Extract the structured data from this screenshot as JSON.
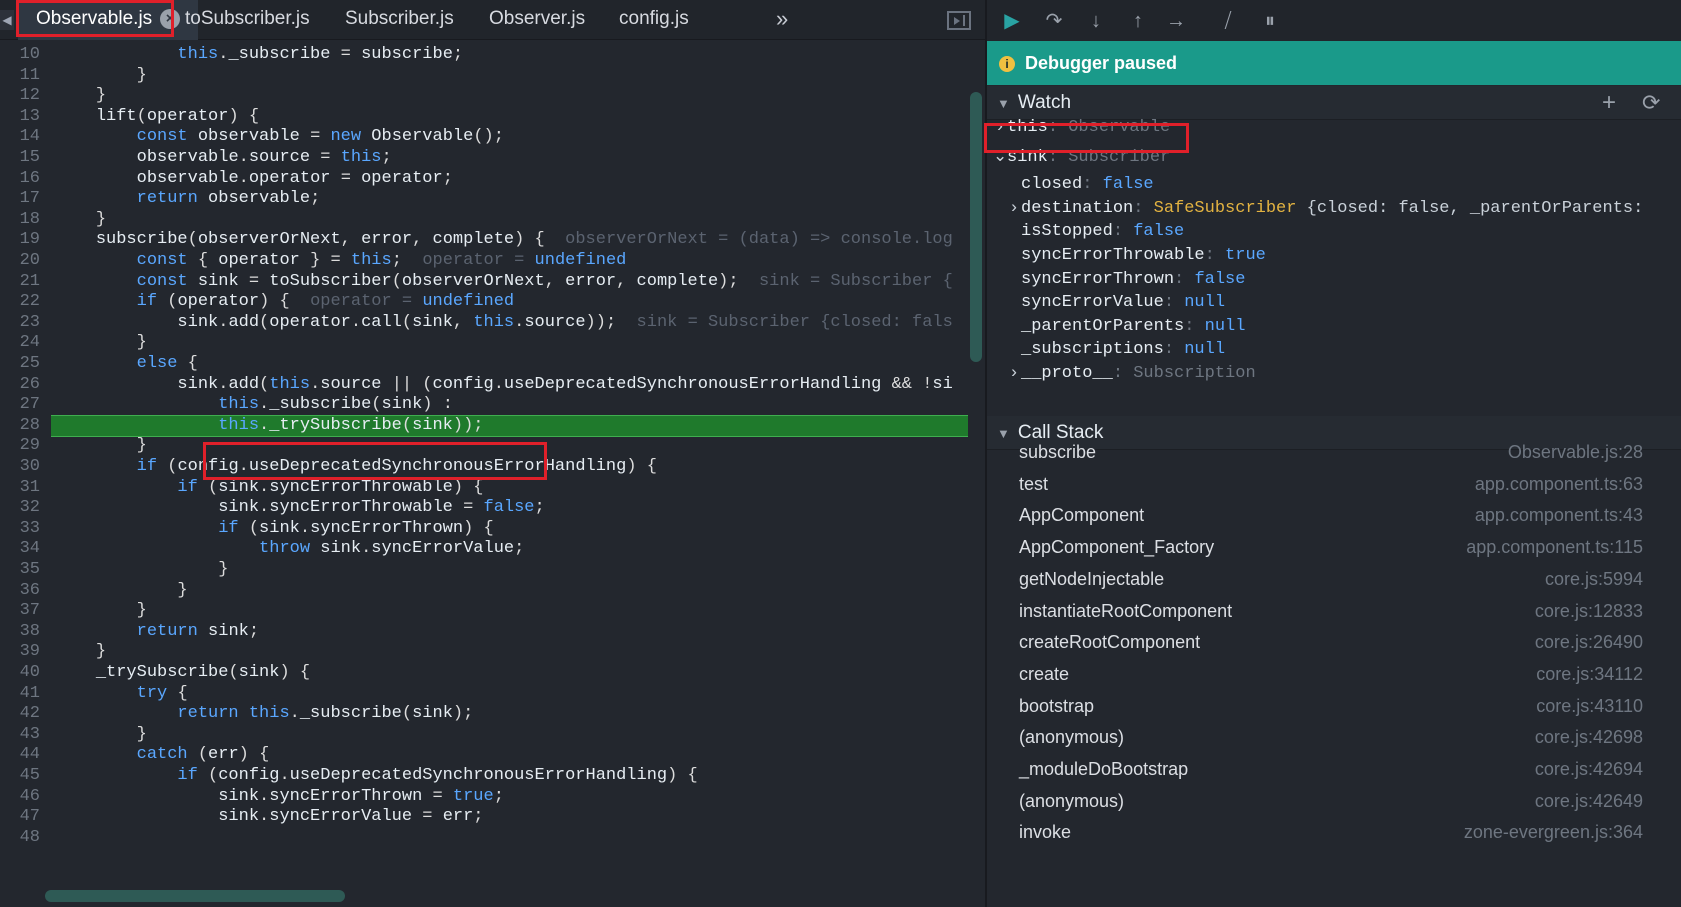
{
  "tabs": {
    "items": [
      {
        "label": "Observable.js",
        "active": true
      },
      {
        "label": "toSubscriber.js"
      },
      {
        "label": "Subscriber.js"
      },
      {
        "label": "Observer.js"
      },
      {
        "label": "config.js"
      }
    ],
    "more": "»",
    "close": "×"
  },
  "editor": {
    "current_line": 28,
    "lines": [
      {
        "n": "10",
        "code": "            this._subscribe = subscribe;"
      },
      {
        "n": "11",
        "code": "        }"
      },
      {
        "n": "12",
        "code": "    }"
      },
      {
        "n": "13",
        "code": "    lift(operator) {"
      },
      {
        "n": "14",
        "code": "        const observable = new Observable();"
      },
      {
        "n": "15",
        "code": "        observable.source = this;"
      },
      {
        "n": "16",
        "code": "        observable.operator = operator;"
      },
      {
        "n": "17",
        "code": "        return observable;"
      },
      {
        "n": "18",
        "code": "    }"
      },
      {
        "n": "19",
        "code": "    subscribe(observerOrNext, error, complete) {",
        "inline": "observerOrNext = (data) => console.log"
      },
      {
        "n": "20",
        "code": "        const { operator } = this;",
        "inline_name": "operator",
        "inline_value": "undefined"
      },
      {
        "n": "21",
        "code": "        const sink = toSubscriber(observerOrNext, error, complete);",
        "inline": "sink = Subscriber {"
      },
      {
        "n": "22",
        "code": "        if (operator) {",
        "inline_name": "operator",
        "inline_value": "undefined"
      },
      {
        "n": "23",
        "code": "            sink.add(operator.call(sink, this.source));",
        "inline": "sink = Subscriber {closed: fals"
      },
      {
        "n": "24",
        "code": "        }"
      },
      {
        "n": "25",
        "code": "        else {"
      },
      {
        "n": "26",
        "code": "            sink.add(this.source || (config.useDeprecatedSynchronousErrorHandling && !si"
      },
      {
        "n": "27",
        "code": "                this._subscribe(sink) :"
      },
      {
        "n": "28",
        "code": "                this._trySubscribe(sink));"
      },
      {
        "n": "29",
        "code": "        }"
      },
      {
        "n": "30",
        "code": "        if (config.useDeprecatedSynchronousErrorHandling) {"
      },
      {
        "n": "31",
        "code": "            if (sink.syncErrorThrowable) {"
      },
      {
        "n": "32",
        "code": "                sink.syncErrorThrowable = false;"
      },
      {
        "n": "33",
        "code": "                if (sink.syncErrorThrown) {"
      },
      {
        "n": "34",
        "code": "                    throw sink.syncErrorValue;"
      },
      {
        "n": "35",
        "code": "                }"
      },
      {
        "n": "36",
        "code": "            }"
      },
      {
        "n": "37",
        "code": "        }"
      },
      {
        "n": "38",
        "code": "        return sink;"
      },
      {
        "n": "39",
        "code": "    }"
      },
      {
        "n": "40",
        "code": "    _trySubscribe(sink) {"
      },
      {
        "n": "41",
        "code": "        try {"
      },
      {
        "n": "42",
        "code": "            return this._subscribe(sink);"
      },
      {
        "n": "43",
        "code": "        }"
      },
      {
        "n": "44",
        "code": "        catch (err) {"
      },
      {
        "n": "45",
        "code": "            if (config.useDeprecatedSynchronousErrorHandling) {"
      },
      {
        "n": "46",
        "code": "                sink.syncErrorThrown = true;"
      },
      {
        "n": "47",
        "code": "                sink.syncErrorValue = err;"
      },
      {
        "n": "48",
        "code": ""
      }
    ]
  },
  "debugger": {
    "toolbar": [
      {
        "icon": "resume-icon",
        "glyph": "▶"
      },
      {
        "icon": "step-over-icon",
        "glyph": "↷"
      },
      {
        "icon": "step-into-icon",
        "glyph": "↓"
      },
      {
        "icon": "step-out-icon",
        "glyph": "↑"
      },
      {
        "icon": "step-icon",
        "glyph": "→"
      },
      {
        "icon": "deactivate-breakpoints-icon",
        "glyph": "⧸"
      },
      {
        "icon": "pause-on-exceptions-icon",
        "glyph": "⏸"
      }
    ],
    "status": "Debugger paused",
    "watch": {
      "title": "Watch",
      "add": "+",
      "refresh": "⟳",
      "rows": [
        {
          "arrow": "›",
          "key": "this",
          "value": "Observable",
          "vclass": "type",
          "indent": 0
        },
        {
          "arrow": "⌄",
          "key": "sink",
          "value": "Subscriber",
          "vclass": "type",
          "indent": 0
        },
        {
          "arrow": "",
          "key": "closed",
          "value": "false",
          "vclass": "kw",
          "indent": 1
        },
        {
          "arrow": "›",
          "key": "destination",
          "value": "SafeSubscriber",
          "vclass": "class",
          "extra": " {closed: false, _parentOrParents:",
          "indent": 1
        },
        {
          "arrow": "",
          "key": "isStopped",
          "value": "false",
          "vclass": "kw",
          "indent": 1
        },
        {
          "arrow": "",
          "key": "syncErrorThrowable",
          "value": "true",
          "vclass": "kw",
          "indent": 1
        },
        {
          "arrow": "",
          "key": "syncErrorThrown",
          "value": "false",
          "vclass": "kw",
          "indent": 1
        },
        {
          "arrow": "",
          "key": "syncErrorValue",
          "value": "null",
          "vclass": "kw",
          "indent": 1
        },
        {
          "arrow": "",
          "key": "_parentOrParents",
          "value": "null",
          "vclass": "kw",
          "indent": 1
        },
        {
          "arrow": "",
          "key": "_subscriptions",
          "value": "null",
          "vclass": "kw",
          "indent": 1
        },
        {
          "arrow": "›",
          "key": "__proto__",
          "value": "Subscription",
          "vclass": "type",
          "indent": 1
        }
      ]
    },
    "callstack": {
      "title": "Call Stack",
      "frames": [
        {
          "fn": "subscribe",
          "loc": "Observable.js:28"
        },
        {
          "fn": "test",
          "loc": "app.component.ts:63"
        },
        {
          "fn": "AppComponent",
          "loc": "app.component.ts:43"
        },
        {
          "fn": "AppComponent_Factory",
          "loc": "app.component.ts:115"
        },
        {
          "fn": "getNodeInjectable",
          "loc": "core.js:5994"
        },
        {
          "fn": "instantiateRootComponent",
          "loc": "core.js:12833"
        },
        {
          "fn": "createRootComponent",
          "loc": "core.js:26490"
        },
        {
          "fn": "create",
          "loc": "core.js:34112"
        },
        {
          "fn": "bootstrap",
          "loc": "core.js:43110"
        },
        {
          "fn": "(anonymous)",
          "loc": "core.js:42698"
        },
        {
          "fn": "_moduleDoBootstrap",
          "loc": "core.js:42694"
        },
        {
          "fn": "(anonymous)",
          "loc": "core.js:42649"
        },
        {
          "fn": "invoke",
          "loc": "zone-evergreen.js:364"
        }
      ]
    }
  },
  "colors": {
    "paused_banner": "#1a9a8a",
    "current_line": "#1f7a2c",
    "highlight_box": "#e0202a"
  }
}
